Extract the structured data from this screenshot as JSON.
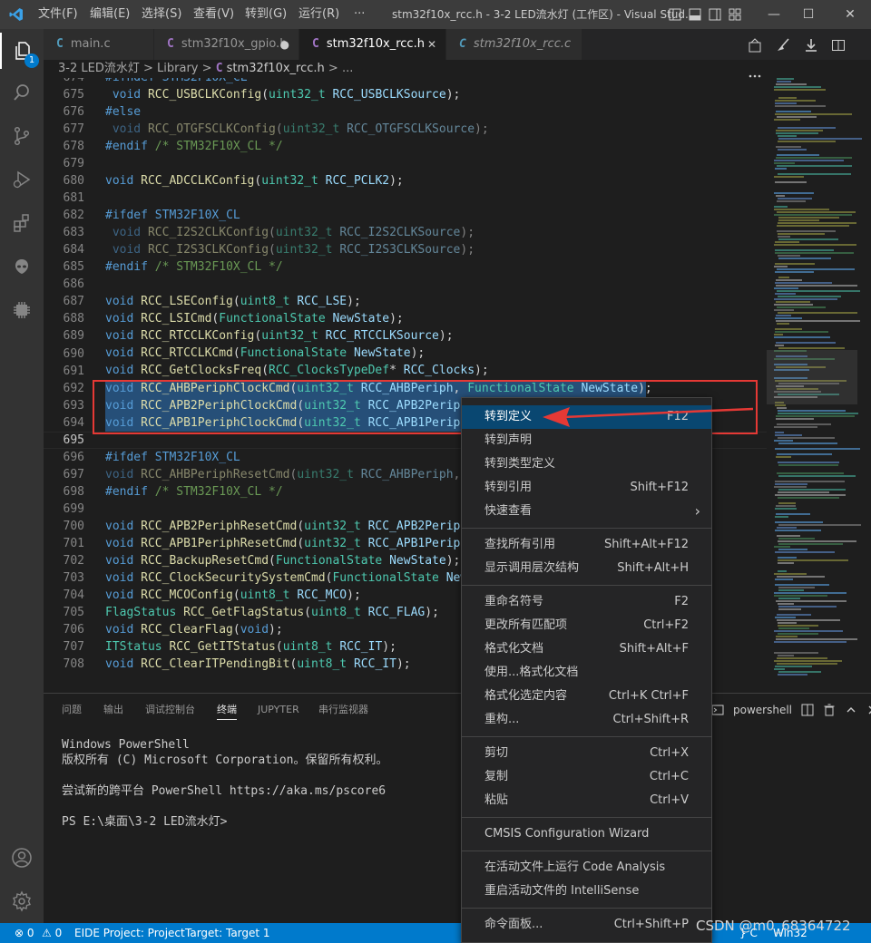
{
  "titlebar": {
    "menus": [
      "文件(F)",
      "编辑(E)",
      "选择(S)",
      "查看(V)",
      "转到(G)",
      "运行(R)",
      "···"
    ],
    "window_title": "stm32f10x_rcc.h - 3-2 LED流水灯 (工作区) - Visual Stud...",
    "controls": [
      "—",
      "☐",
      "✕"
    ]
  },
  "activity": {
    "badge": "1"
  },
  "tabs": [
    {
      "icon": "C",
      "label": "main.c"
    },
    {
      "icon": "C",
      "label": "stm32f10x_gpio.h",
      "dirty": "●"
    },
    {
      "icon": "C",
      "label": "stm32f10x_rcc.h",
      "close": "✕"
    },
    {
      "icon": "C",
      "label": "stm32f10x_rcc.c"
    }
  ],
  "breadcrumb": {
    "folder": "3-2 LED流水灯",
    "sep": ">",
    "sub": "Library",
    "icon": "C",
    "file": "stm32f10x_rcc.h",
    "tail": "> ..."
  },
  "editor": {
    "line_numbers": [
      "674",
      "675",
      "676",
      "677",
      "678",
      "679",
      "680",
      "681",
      "682",
      "683",
      "684",
      "685",
      "686",
      "687",
      "688",
      "689",
      "690",
      "691",
      "692",
      "693",
      "694",
      "695",
      "696",
      "697",
      "698",
      "699",
      "700",
      "701",
      "702",
      "703",
      "704",
      "705",
      "706",
      "707",
      "708"
    ]
  },
  "panel": {
    "tabs": [
      "问题",
      "输出",
      "调试控制台",
      "终端",
      "JUPYTER",
      "串行监视器"
    ],
    "shell": "powershell",
    "terminal_lines": [
      "Windows PowerShell",
      "版权所有 (C) Microsoft Corporation。保留所有权利。",
      "",
      "尝试新的跨平台 PowerShell https://aka.ms/pscore6",
      "",
      "PS E:\\桌面\\3-2 LED流水灯>"
    ]
  },
  "context_menu": {
    "items": [
      {
        "label": "转到定义",
        "key": "F12"
      },
      {
        "label": "转到声明",
        "key": ""
      },
      {
        "label": "转到类型定义",
        "key": ""
      },
      {
        "label": "转到引用",
        "key": "Shift+F12"
      },
      {
        "label": "快速查看",
        "key": "›"
      },
      {
        "label": "查找所有引用",
        "key": "Shift+Alt+F12"
      },
      {
        "label": "显示调用层次结构",
        "key": "Shift+Alt+H"
      },
      {
        "label": "重命名符号",
        "key": "F2"
      },
      {
        "label": "更改所有匹配项",
        "key": "Ctrl+F2"
      },
      {
        "label": "格式化文档",
        "key": "Shift+Alt+F"
      },
      {
        "label": "使用...格式化文档",
        "key": ""
      },
      {
        "label": "格式化选定内容",
        "key": "Ctrl+K Ctrl+F"
      },
      {
        "label": "重构...",
        "key": "Ctrl+Shift+R"
      },
      {
        "label": "剪切",
        "key": "Ctrl+X"
      },
      {
        "label": "复制",
        "key": "Ctrl+C"
      },
      {
        "label": "粘贴",
        "key": "Ctrl+V"
      },
      {
        "label": "CMSIS Configuration Wizard",
        "key": ""
      },
      {
        "label": "在活动文件上运行 Code Analysis",
        "key": ""
      },
      {
        "label": "重启活动文件的 IntelliSense",
        "key": ""
      },
      {
        "label": "命令面板...",
        "key": "Ctrl+Shift+P"
      }
    ]
  },
  "statusbar": {
    "errors": "⊗ 0",
    "warnings": "⚠ 0",
    "project": "EIDE Project: Project",
    "target": "Target: Target 1",
    "lang": "} C",
    "platform": "Win32"
  },
  "watermark": "CSDN @m0_68364722",
  "colors": {
    "accent": "#007acc",
    "highlight_box": "#e53935",
    "selection": "#264f78"
  }
}
